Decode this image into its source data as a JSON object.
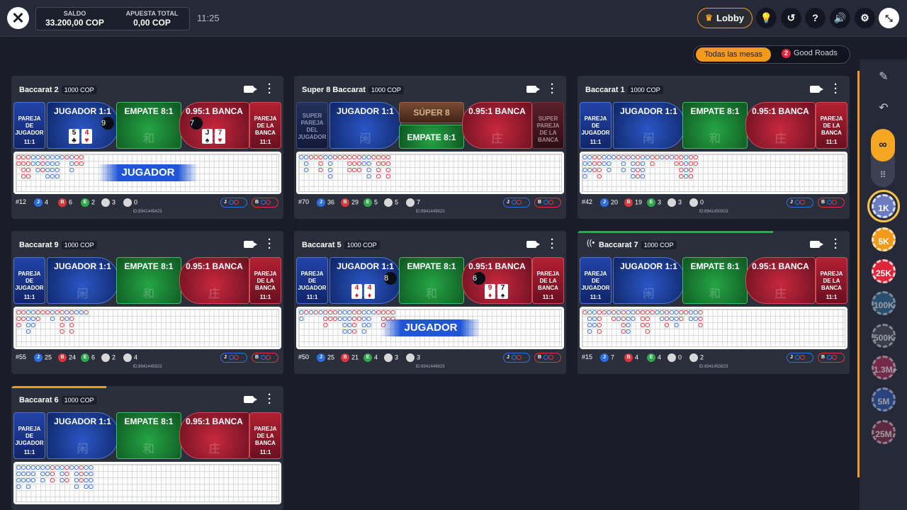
{
  "header": {
    "balance_label": "SALDO",
    "balance_value": "33.200,00 COP",
    "bet_label": "APUESTA TOTAL",
    "bet_value": "0,00 COP",
    "time": "11:25",
    "lobby_label": "Lobby",
    "icons": [
      "close-icon",
      "crown-icon",
      "lightbulb-icon",
      "history-icon",
      "help-icon",
      "sound-icon",
      "settings-icon",
      "collapse-icon"
    ]
  },
  "filter": {
    "all_label": "Todas las mesas",
    "good_count": "2",
    "good_label": "Good Roads"
  },
  "labels": {
    "player_pair": "PAREJA DE JUGADOR",
    "banker_pair": "PAREJA DE LA BANCA",
    "pair_odds": "11:1",
    "player": "JUGADOR 1:1",
    "tie": "EMPATE 8:1",
    "banker": "0.95:1 BANCA",
    "super_pp": "SUPER PAREJA DEL JUGADOR",
    "super_bp": "SUPER PAREJA DE LA BANCA",
    "super8": "SÚPER 8",
    "glyph_player": "闲",
    "glyph_tie": "和",
    "glyph_banker": "庄",
    "J": "J",
    "B": "B",
    "E": "E"
  },
  "tables": [
    {
      "name": "Baccarat 2",
      "limit": "1000 COP",
      "progress": 0,
      "progress_color": "#2fa84b",
      "banner": "JUGADOR",
      "player_score": "9",
      "banker_score": "7",
      "player_cards": [
        [
          "5",
          "♣",
          "blk"
        ],
        [
          "4",
          "♥",
          "red"
        ]
      ],
      "banker_cards": [
        [
          "J",
          "♠",
          "blk"
        ],
        [
          "7",
          "♥",
          "red"
        ]
      ],
      "stats": {
        "num": "#12",
        "j": "4",
        "b": "6",
        "e": "2",
        "pp": "3",
        "bp": "0"
      },
      "id": "ID:8941449423"
    },
    {
      "name": "Super 8 Baccarat",
      "limit": "1000 COP",
      "progress": 0,
      "progress_color": "#2fa84b",
      "banner": "",
      "super": true,
      "stats": {
        "num": "#70",
        "j": "36",
        "b": "29",
        "e": "5",
        "pp": "5",
        "bp": "7"
      },
      "id": "ID:8941449823"
    },
    {
      "name": "Baccarat 1",
      "limit": "1000 COP",
      "progress": 0,
      "progress_color": "#2fa84b",
      "banner": "",
      "stats": {
        "num": "#42",
        "j": "20",
        "b": "19",
        "e": "3",
        "pp": "3",
        "bp": "0"
      },
      "id": "ID:8941450823"
    },
    {
      "name": "Baccarat 9",
      "limit": "1000 COP",
      "progress": 0,
      "progress_color": "#2fa84b",
      "banner": "",
      "stats": {
        "num": "#55",
        "j": "25",
        "b": "24",
        "e": "6",
        "pp": "2",
        "bp": "4"
      },
      "id": "ID:8941445823"
    },
    {
      "name": "Baccarat 5",
      "limit": "1000 COP",
      "progress": 0,
      "progress_color": "#2fa84b",
      "banner": "JUGADOR",
      "player_score": "8",
      "banker_score": "6",
      "player_cards": [
        [
          "4",
          "♦",
          "red"
        ],
        [
          "4",
          "♦",
          "red"
        ]
      ],
      "banker_cards": [
        [
          "9",
          "♦",
          "red"
        ],
        [
          "7",
          "♠",
          "blk"
        ]
      ],
      "stats": {
        "num": "#50",
        "j": "25",
        "b": "21",
        "e": "4",
        "pp": "3",
        "bp": "3"
      },
      "id": "ID:8941449823"
    },
    {
      "name": "Baccarat 7",
      "limit": "1000 COP",
      "progress": 0.72,
      "progress_color": "#2fa84b",
      "banner": "",
      "live": true,
      "stats": {
        "num": "#15",
        "j": "7",
        "b": "4",
        "e": "4",
        "pp": "0",
        "bp": "2"
      },
      "id": "ID:8941453823"
    },
    {
      "name": "Baccarat 6",
      "limit": "1000 COP",
      "progress": 0.35,
      "progress_color": "#f39a1d",
      "banner": "",
      "stats": {
        "num": "",
        "j": "",
        "b": "",
        "e": "",
        "pp": "",
        "bp": ""
      },
      "id": ""
    }
  ],
  "chips": [
    {
      "label": "1K",
      "color": "#6a7cbf",
      "selected": true,
      "dim": false
    },
    {
      "label": "5K",
      "color": "#f29a1b",
      "selected": false,
      "dim": false
    },
    {
      "label": "25K",
      "color": "#e0243a",
      "selected": false,
      "dim": false
    },
    {
      "label": "100K",
      "color": "#2a6e9a",
      "selected": false,
      "dim": true
    },
    {
      "label": "500K",
      "color": "#4a4d58",
      "selected": false,
      "dim": true
    },
    {
      "label": "1.3M+",
      "color": "#b42a5a",
      "selected": false,
      "dim": true
    },
    {
      "label": "5M",
      "color": "#2c5ab8",
      "selected": false,
      "dim": true
    },
    {
      "label": "25M",
      "color": "#8a2a4a",
      "selected": false,
      "dim": true
    }
  ]
}
